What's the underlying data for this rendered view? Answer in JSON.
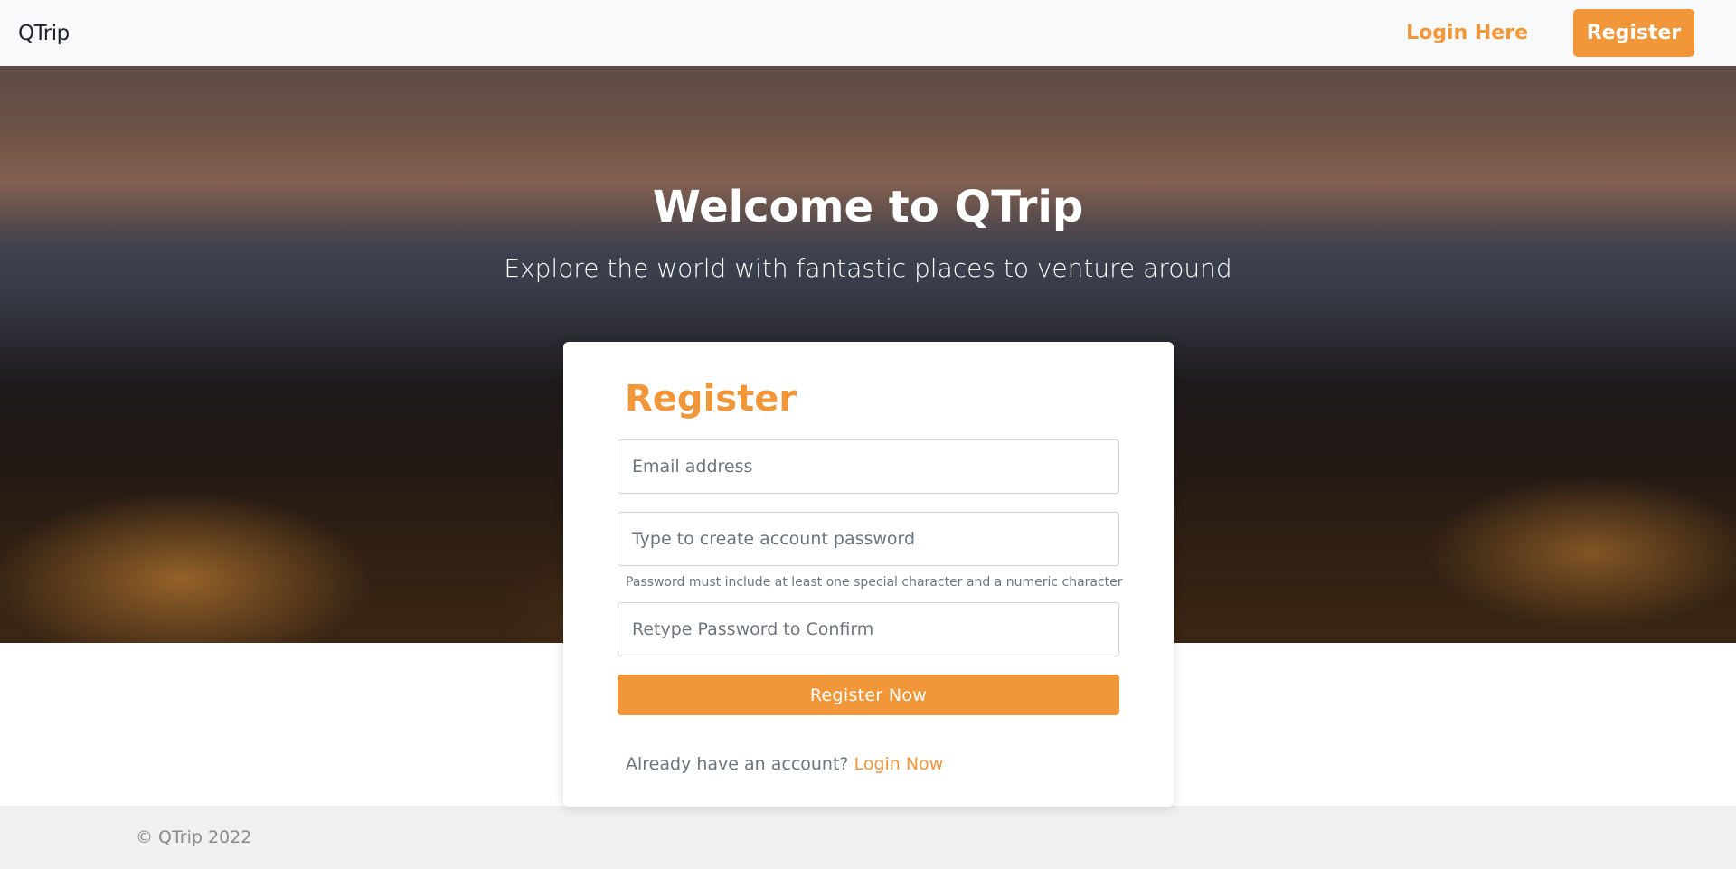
{
  "nav": {
    "brand": "QTrip",
    "login_label": "Login Here",
    "register_label": "Register"
  },
  "hero": {
    "title": "Welcome to QTrip",
    "subtitle": "Explore the world with fantastic places to venture around"
  },
  "form": {
    "title": "Register",
    "email": {
      "value": "",
      "placeholder": "Email address"
    },
    "password": {
      "value": "",
      "placeholder": "Type to create account password"
    },
    "password_hint": "Password must include at least one special character and a numeric character",
    "confirm": {
      "value": "",
      "placeholder": "Retype Password to Confirm"
    },
    "submit_label": "Register Now",
    "login_prompt": "Already have an account?",
    "login_link": "Login Now"
  },
  "footer": {
    "text": "© QTrip 2022"
  },
  "colors": {
    "accent": "#f2963a",
    "nav_bg": "#f8f9fa",
    "footer_bg": "#f0f0f0"
  }
}
